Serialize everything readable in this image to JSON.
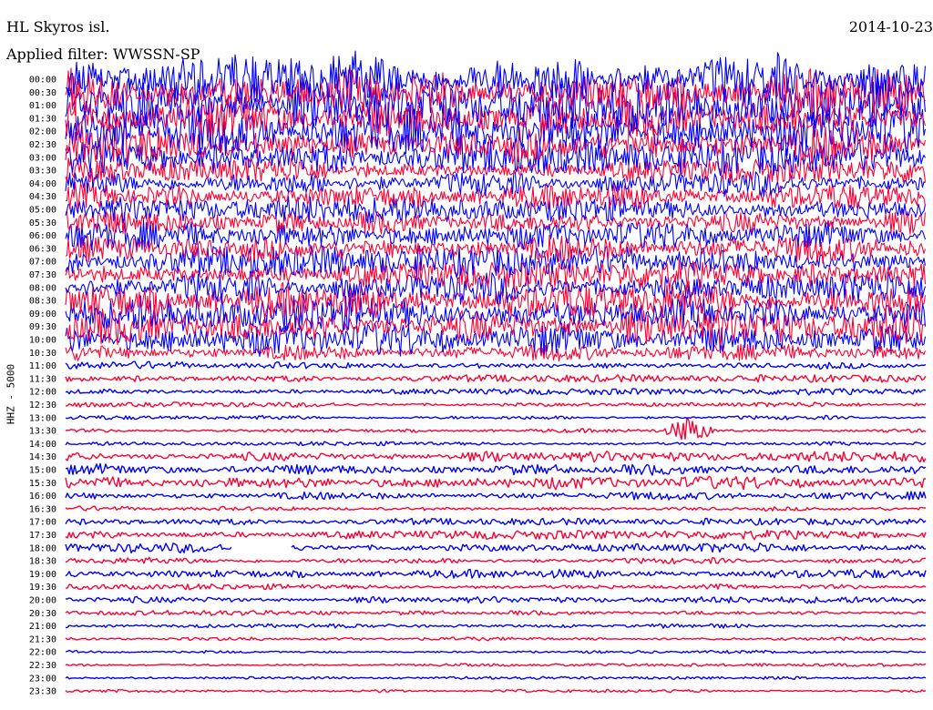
{
  "header": {
    "station": "HL Skyros isl.",
    "date": "2014-10-23",
    "filter": "Applied filter: WWSSN-SP"
  },
  "chart_data": {
    "type": "helicorder",
    "ylabel": "HHZ - 5000",
    "row_labels": [
      "00:00",
      "00:30",
      "01:00",
      "01:30",
      "02:00",
      "02:30",
      "03:00",
      "03:30",
      "04:00",
      "04:30",
      "05:00",
      "05:30",
      "06:00",
      "06:30",
      "07:00",
      "07:30",
      "08:00",
      "08:30",
      "09:00",
      "09:30",
      "10:00",
      "10:30",
      "11:00",
      "11:30",
      "12:00",
      "12:30",
      "13:00",
      "13:30",
      "14:00",
      "14:30",
      "15:00",
      "15:30",
      "16:00",
      "16:30",
      "17:00",
      "17:30",
      "18:00",
      "18:30",
      "19:00",
      "19:30",
      "20:00",
      "20:30",
      "21:00",
      "21:30",
      "22:00",
      "22:30",
      "23:00",
      "23:30"
    ],
    "colors": [
      "#0000ff",
      "#ff0033"
    ],
    "amplitude_rel": [
      3.8,
      3.4,
      3.6,
      3.2,
      3.4,
      3.0,
      2.4,
      1.8,
      1.8,
      1.9,
      1.9,
      1.8,
      2.0,
      2.1,
      2.1,
      2.0,
      2.3,
      2.6,
      2.7,
      2.6,
      2.4,
      1.2,
      0.55,
      0.5,
      0.45,
      0.35,
      0.3,
      0.3,
      0.3,
      0.75,
      0.85,
      0.95,
      0.6,
      0.35,
      0.45,
      0.65,
      0.7,
      0.45,
      0.65,
      0.4,
      0.45,
      0.35,
      0.3,
      0.25,
      0.22,
      0.2,
      0.2,
      0.2
    ],
    "gaps": [
      {
        "row": "18:00",
        "start_frac": 0.193,
        "end_frac": 0.262
      }
    ],
    "events": [
      {
        "row": "13:30",
        "frac": 0.725,
        "amp_rel": 2.5
      }
    ]
  }
}
